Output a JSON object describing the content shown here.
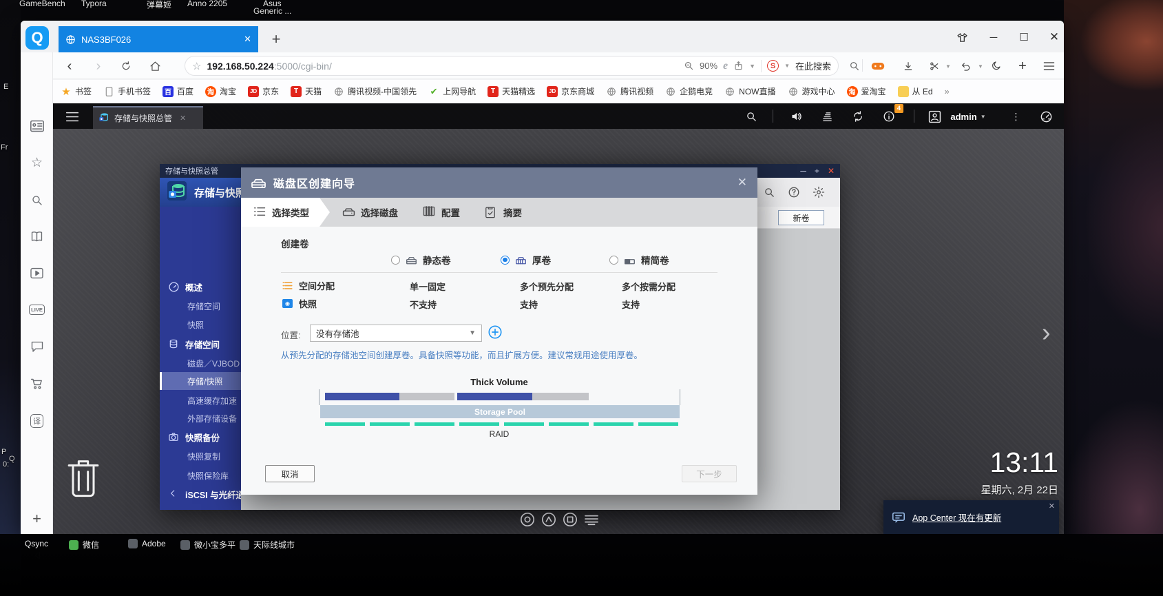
{
  "desktop": {
    "top_icons": [
      "GameBench",
      "Typora",
      "弹幕姬",
      "Anno 2205",
      "Asus",
      "Generic ..."
    ],
    "edge_labels": [
      "E",
      "Fr",
      "P",
      "0:",
      "Q"
    ],
    "taskbar_items": [
      "Qsync",
      "微信",
      "Adobe",
      "微小宝多平",
      "天际线城市"
    ],
    "clock": {
      "time": "13:11",
      "date": "星期六, 2月 22日"
    },
    "notification": {
      "text": "App Center 现在有更新"
    }
  },
  "browser": {
    "tab_title": "NAS3BF026",
    "new_tab": "+",
    "url_host": "192.168.50.224",
    "url_rest": ":5000/cgi-bin/",
    "zoom_level": "90%",
    "search_label": "在此搜索",
    "bookmarks": [
      {
        "label": "书签"
      },
      {
        "label": "手机书签"
      },
      {
        "label": "百度"
      },
      {
        "label": "淘宝"
      },
      {
        "label": "京东"
      },
      {
        "label": "天猫"
      },
      {
        "label": "腾讯视频-中国领先"
      },
      {
        "label": "上网导航"
      },
      {
        "label": "天猫精选"
      },
      {
        "label": "京东商城"
      },
      {
        "label": "腾讯视频"
      },
      {
        "label": "企鹅电竞"
      },
      {
        "label": "NOW直播"
      },
      {
        "label": "游戏中心"
      },
      {
        "label": "爱淘宝"
      },
      {
        "label": "从 Ed"
      }
    ],
    "bookmarks_overflow": "»"
  },
  "nas": {
    "topbar": {
      "tab_label": "存储与快照总管",
      "user": "admin",
      "info_badge": "4"
    },
    "window": {
      "titlebar": "存储与快照总管",
      "app_title": "存储与快照总管",
      "new_volume_button": "新卷",
      "sidebar": {
        "items": [
          {
            "label": "概述"
          },
          {
            "label": "存储空间"
          },
          {
            "label": "快照"
          },
          {
            "label": "存储空间"
          },
          {
            "label": "磁盘／VJBOD"
          },
          {
            "label": "存储/快照"
          },
          {
            "label": "高速缓存加速"
          },
          {
            "label": "外部存储设备"
          },
          {
            "label": "快照备份"
          },
          {
            "label": "快照复制"
          },
          {
            "label": "快照保险库"
          },
          {
            "label": "iSCSI 与光纤通道"
          }
        ]
      }
    },
    "dialog": {
      "title": "磁盘区创建向导",
      "steps": [
        {
          "label": "选择类型"
        },
        {
          "label": "选择磁盘"
        },
        {
          "label": "配置"
        },
        {
          "label": "摘要"
        }
      ],
      "create_label": "创建卷",
      "options": [
        {
          "label": "静态卷"
        },
        {
          "label": "厚卷"
        },
        {
          "label": "精简卷"
        }
      ],
      "rows": [
        {
          "name": "空间分配",
          "v1": "单一固定",
          "v2": "多个预先分配",
          "v3": "多个按需分配"
        },
        {
          "name": "快照",
          "v1": "不支持",
          "v2": "支持",
          "v3": "支持"
        }
      ],
      "location_label": "位置:",
      "location_value": "没有存储池",
      "description": "从预先分配的存储池空间创建厚卷。具备快照等功能，而且扩展方便。建议常规用途使用厚卷。",
      "diagram": {
        "title": "Thick Volume",
        "pool": "Storage Pool",
        "raid": "RAID"
      },
      "cancel": "取消",
      "next": "下一步"
    }
  },
  "colors": {
    "tab_blue": "#1283e2",
    "sidebar_blue": "#2c3a94",
    "dialog_header": "#6f7a93",
    "teal": "#2bd4ad",
    "bar_blue": "#3f51a8",
    "pool": "#b7c9d9",
    "badge_orange": "#f59a23"
  }
}
